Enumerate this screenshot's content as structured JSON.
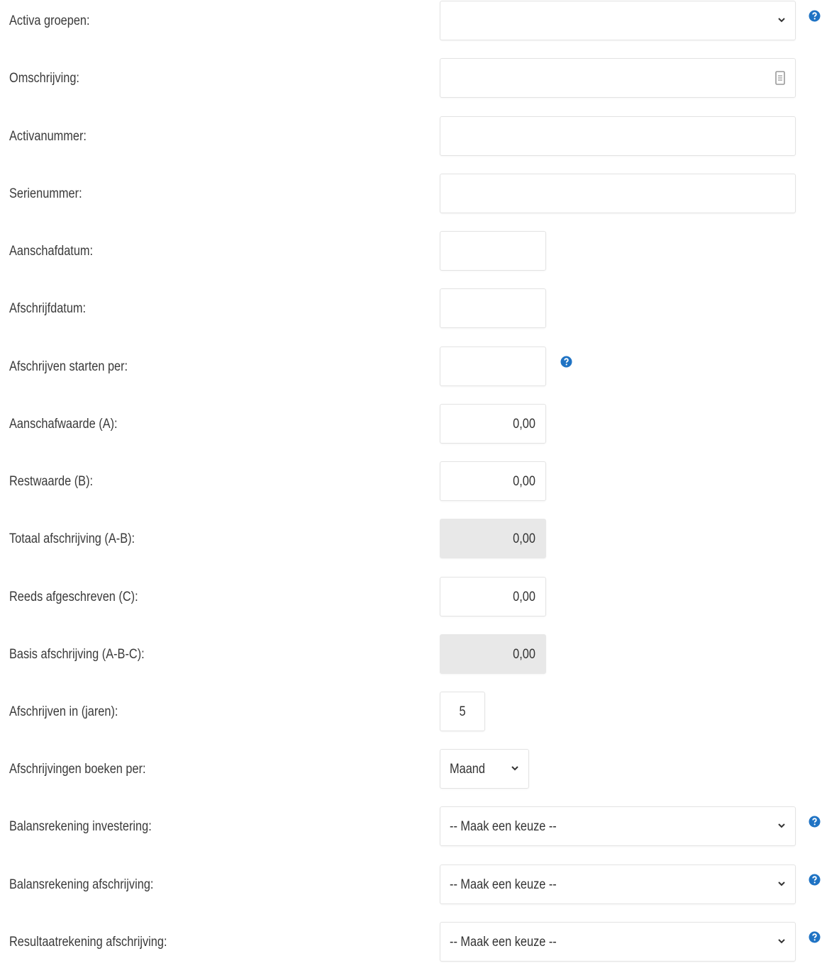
{
  "colors": {
    "help_icon": "#1f73c4",
    "readonly_bg": "#e8e8e8",
    "border": "#e3e3e3"
  },
  "icons": {
    "help": "question-circle-icon",
    "dropdown": "chevron-down-icon",
    "text_lookup": "document-icon"
  },
  "form": {
    "activa_groepen": {
      "label": "Activa groepen:",
      "value": ""
    },
    "omschrijving": {
      "label": "Omschrijving:",
      "value": ""
    },
    "activanummer": {
      "label": "Activanummer:",
      "value": ""
    },
    "serienummer": {
      "label": "Serienummer:",
      "value": ""
    },
    "aanschafdatum": {
      "label": "Aanschafdatum:",
      "value": ""
    },
    "afschrijfdatum": {
      "label": "Afschrijfdatum:",
      "value": ""
    },
    "afschrijven_starten_per": {
      "label": "Afschrijven starten per:",
      "value": ""
    },
    "aanschafwaarde": {
      "label": "Aanschafwaarde (A):",
      "value": "0,00"
    },
    "restwaarde": {
      "label": "Restwaarde (B):",
      "value": "0,00"
    },
    "totaal_afschrijving": {
      "label": "Totaal afschrijving (A-B):",
      "value": "0,00"
    },
    "reeds_afgeschreven": {
      "label": "Reeds afgeschreven (C):",
      "value": "0,00"
    },
    "basis_afschrijving": {
      "label": "Basis afschrijving (A-B-C):",
      "value": "0,00"
    },
    "afschrijven_in_jaren": {
      "label": "Afschrijven in (jaren):",
      "value": "5"
    },
    "afschrijvingen_boeken_per": {
      "label": "Afschrijvingen boeken per:",
      "value": "Maand"
    },
    "balansrekening_investering": {
      "label": "Balansrekening investering:",
      "value": "-- Maak een keuze --"
    },
    "balansrekening_afschrijving": {
      "label": "Balansrekening afschrijving:",
      "value": "-- Maak een keuze --"
    },
    "resultaatrekening_afschrijving": {
      "label": "Resultaatrekening afschrijving:",
      "value": "-- Maak een keuze --"
    }
  }
}
